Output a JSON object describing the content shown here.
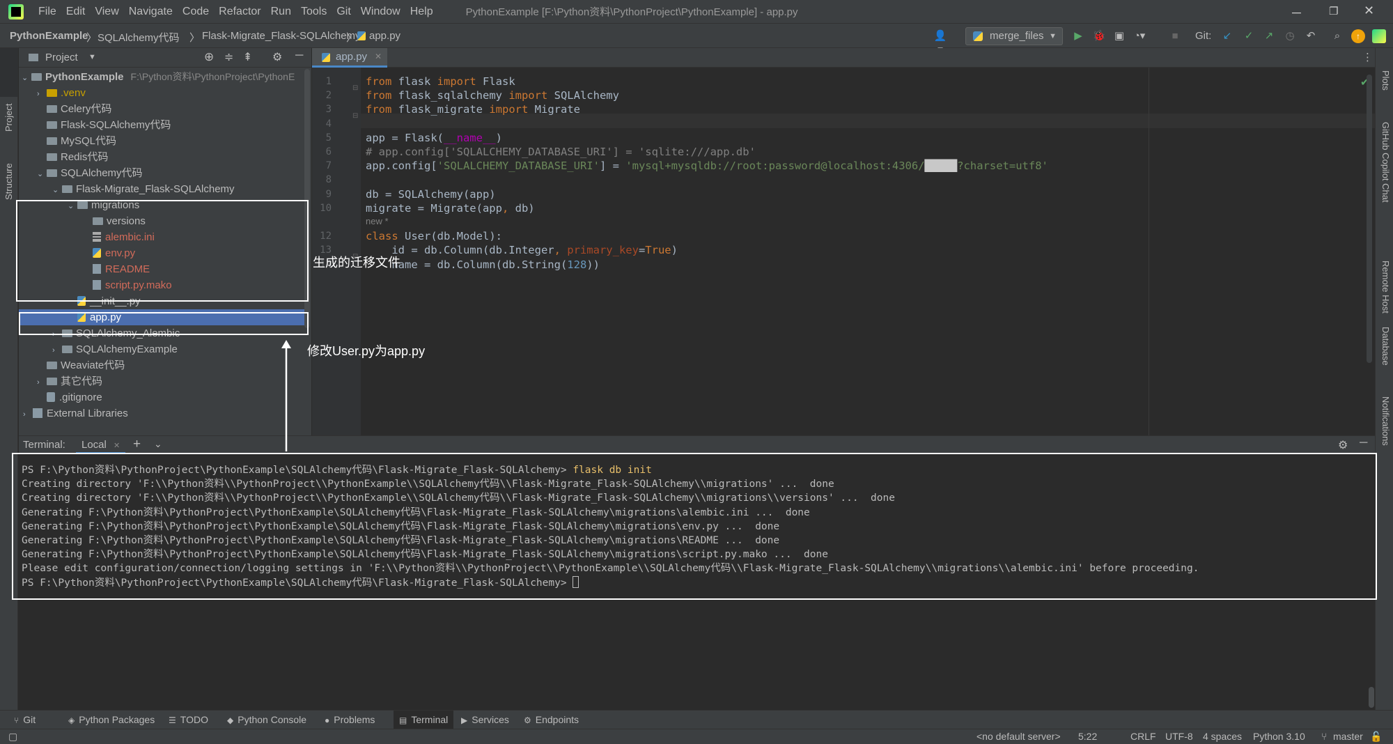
{
  "menu": {
    "items": [
      "File",
      "Edit",
      "View",
      "Navigate",
      "Code",
      "Refactor",
      "Run",
      "Tools",
      "Git",
      "Window",
      "Help"
    ],
    "title": "PythonExample [F:\\Python资料\\PythonProject\\PythonExample] - app.py"
  },
  "breadcrumb": [
    "PythonExample",
    "SQLAlchemy代码",
    "Flask-Migrate_Flask-SQLAlchemy",
    "app.py"
  ],
  "toolbar": {
    "run_config": "merge_files",
    "git_label": "Git:"
  },
  "left_stripe": {
    "project": "Project",
    "structure": "Structure"
  },
  "right_stripe": {
    "plots": "Plots",
    "copilot": "GitHub Copilot Chat",
    "remote": "Remote Host",
    "database": "Database",
    "notifications": "Notifications"
  },
  "project": {
    "title": "Project",
    "root": {
      "name": "PythonExample",
      "path": "F:\\Python资料\\PythonProject\\PythonE"
    },
    "items": [
      ".venv",
      "Celery代码",
      "Flask-SQLAlchemy代码",
      "MySQL代码",
      "Redis代码",
      "SQLAlchemy代码",
      "Flask-Migrate_Flask-SQLAlchemy",
      "migrations",
      "versions",
      "alembic.ini",
      "env.py",
      "README",
      "script.py.mako",
      "__init__.py",
      "app.py",
      "SQLAlchemy_Alembic",
      "SQLAlchemyExample",
      "Weaviate代码",
      "其它代码",
      ".gitignore",
      "External Libraries"
    ]
  },
  "editor": {
    "tab": "app.py",
    "lines": [
      {
        "n": "1",
        "parts": [
          [
            "kw",
            "from "
          ],
          [
            "",
            "flask "
          ],
          [
            "kw",
            "import "
          ],
          [
            "",
            "Flask"
          ]
        ]
      },
      {
        "n": "2",
        "parts": [
          [
            "kw",
            "from "
          ],
          [
            "",
            "flask_sqlalchemy "
          ],
          [
            "kw",
            "import "
          ],
          [
            "",
            "SQLAlchemy"
          ]
        ]
      },
      {
        "n": "3",
        "parts": [
          [
            "kw",
            "from "
          ],
          [
            "",
            "flask_migrate "
          ],
          [
            "kw",
            "import "
          ],
          [
            "",
            "Migrate"
          ]
        ]
      },
      {
        "n": "4",
        "parts": []
      },
      {
        "n": "5",
        "parts": [
          [
            "",
            "app = Flask("
          ],
          [
            "dnd",
            "__name__"
          ],
          [
            "",
            ")"
          ]
        ]
      },
      {
        "n": "6",
        "parts": [
          [
            "cm",
            "# app.config['SQLALCHEMY_DATABASE_URI'] = 'sqlite:///app.db'"
          ]
        ]
      },
      {
        "n": "7",
        "parts": [
          [
            "",
            "app.config["
          ],
          [
            "str",
            "'SQLALCHEMY_DATABASE_URI'"
          ],
          [
            "",
            "] = "
          ],
          [
            "str",
            "'mysql+mysqldb://root:password@localhost:4306/"
          ],
          [
            "str",
            "█████"
          ],
          [
            "str",
            "?charset=utf8'"
          ]
        ]
      },
      {
        "n": "8",
        "parts": []
      },
      {
        "n": "9",
        "parts": [
          [
            "",
            "db = SQLAlchemy(app)"
          ]
        ]
      },
      {
        "n": "10",
        "parts": [
          [
            "",
            "migrate = Migrate(app"
          ],
          [
            "kw",
            ", "
          ],
          [
            "",
            "db)"
          ]
        ]
      },
      {
        "n": "",
        "parts": [
          [
            "cm",
            "new *"
          ]
        ]
      },
      {
        "n": "12",
        "parts": [
          [
            "kw",
            "class "
          ],
          [
            "",
            "User(db.Model):"
          ]
        ]
      },
      {
        "n": "13",
        "parts": [
          [
            "",
            "    id = db.Column(db.Integer"
          ],
          [
            "kw",
            ", "
          ],
          [
            "prm",
            "primary_key"
          ],
          [
            "",
            "="
          ],
          [
            "kw",
            "True"
          ],
          [
            "",
            ")"
          ]
        ]
      },
      {
        "n": "14",
        "parts": [
          [
            "",
            "    name = db.Column(db.String("
          ],
          [
            "num",
            "128"
          ],
          [
            "",
            "))"
          ]
        ]
      }
    ]
  },
  "terminal": {
    "title": "Terminal:",
    "tab": "Local",
    "lines": [
      "PS F:\\Python资料\\PythonProject\\PythonExample\\SQLAlchemy代码\\Flask-Migrate_Flask-SQLAlchemy> ",
      "Creating directory 'F:\\\\Python资料\\\\PythonProject\\\\PythonExample\\\\SQLAlchemy代码\\\\Flask-Migrate_Flask-SQLAlchemy\\\\migrations' ...  done",
      "Creating directory 'F:\\\\Python资料\\\\PythonProject\\\\PythonExample\\\\SQLAlchemy代码\\\\Flask-Migrate_Flask-SQLAlchemy\\\\migrations\\\\versions' ...  done",
      "Generating F:\\Python资料\\PythonProject\\PythonExample\\SQLAlchemy代码\\Flask-Migrate_Flask-SQLAlchemy\\migrations\\alembic.ini ...  done",
      "Generating F:\\Python资料\\PythonProject\\PythonExample\\SQLAlchemy代码\\Flask-Migrate_Flask-SQLAlchemy\\migrations\\env.py ...  done",
      "Generating F:\\Python资料\\PythonProject\\PythonExample\\SQLAlchemy代码\\Flask-Migrate_Flask-SQLAlchemy\\migrations\\README ...  done",
      "Generating F:\\Python资料\\PythonProject\\PythonExample\\SQLAlchemy代码\\Flask-Migrate_Flask-SQLAlchemy\\migrations\\script.py.mako ...  done",
      "Please edit configuration/connection/logging settings in 'F:\\\\Python资料\\\\PythonProject\\\\PythonExample\\\\SQLAlchemy代码\\\\Flask-Migrate_Flask-SQLAlchemy\\\\migrations\\\\alembic.ini' before proceeding.",
      "PS F:\\Python资料\\PythonProject\\PythonExample\\SQLAlchemy代码\\Flask-Migrate_Flask-SQLAlchemy> "
    ],
    "command": "flask db init"
  },
  "annotations": {
    "generated": "生成的迁移文件",
    "renamed": "修改User.py为app.py"
  },
  "bottom_tabs": [
    "Git",
    "Python Packages",
    "TODO",
    "Python Console",
    "Problems",
    "Terminal",
    "Services",
    "Endpoints"
  ],
  "status": {
    "server": "<no default server>",
    "pos": "5:22",
    "eol": "CRLF",
    "enc": "UTF-8",
    "indent": "4 spaces",
    "interp": "Python 3.10",
    "branch": "master"
  }
}
